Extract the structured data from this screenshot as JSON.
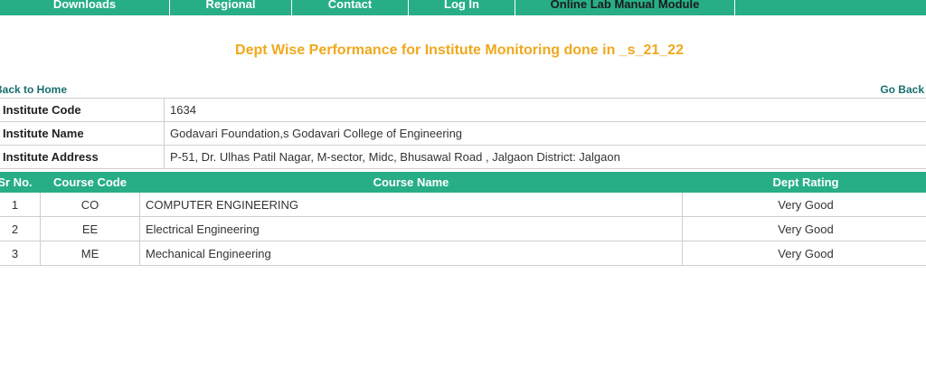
{
  "nav": {
    "items": [
      {
        "label": "Downloads"
      },
      {
        "label": "Regional"
      },
      {
        "label": "Contact"
      },
      {
        "label": "Log In"
      },
      {
        "label": "Online Lab Manual Module"
      }
    ]
  },
  "page": {
    "title": "Dept Wise Performance for Institute Monitoring done in _s_21_22"
  },
  "links": {
    "back_home": "Back to Home",
    "go_back": "Go Back"
  },
  "institute": {
    "code_label": "Institute Code",
    "code_value": "1634",
    "name_label": "Institute Name",
    "name_value": "Godavari Foundation,s Godavari College of Engineering",
    "address_label": "Institute Address",
    "address_value": "P-51, Dr. Ulhas Patil Nagar, M-sector, Midc, Bhusawal Road , Jalgaon District: Jalgaon"
  },
  "courses": {
    "headers": {
      "sr": "Sr No.",
      "code": "Course Code",
      "name": "Course Name",
      "rating": "Dept Rating"
    },
    "rows": [
      {
        "sr": "1",
        "code": "CO",
        "name": "COMPUTER ENGINEERING",
        "rating": "Very Good"
      },
      {
        "sr": "2",
        "code": "EE",
        "name": "Electrical Engineering",
        "rating": "Very Good"
      },
      {
        "sr": "3",
        "code": "ME",
        "name": "Mechanical Engineering",
        "rating": "Very Good"
      }
    ]
  },
  "colors": {
    "accent": "#27ae86",
    "title": "#f0a81d",
    "link": "#186f6f"
  }
}
